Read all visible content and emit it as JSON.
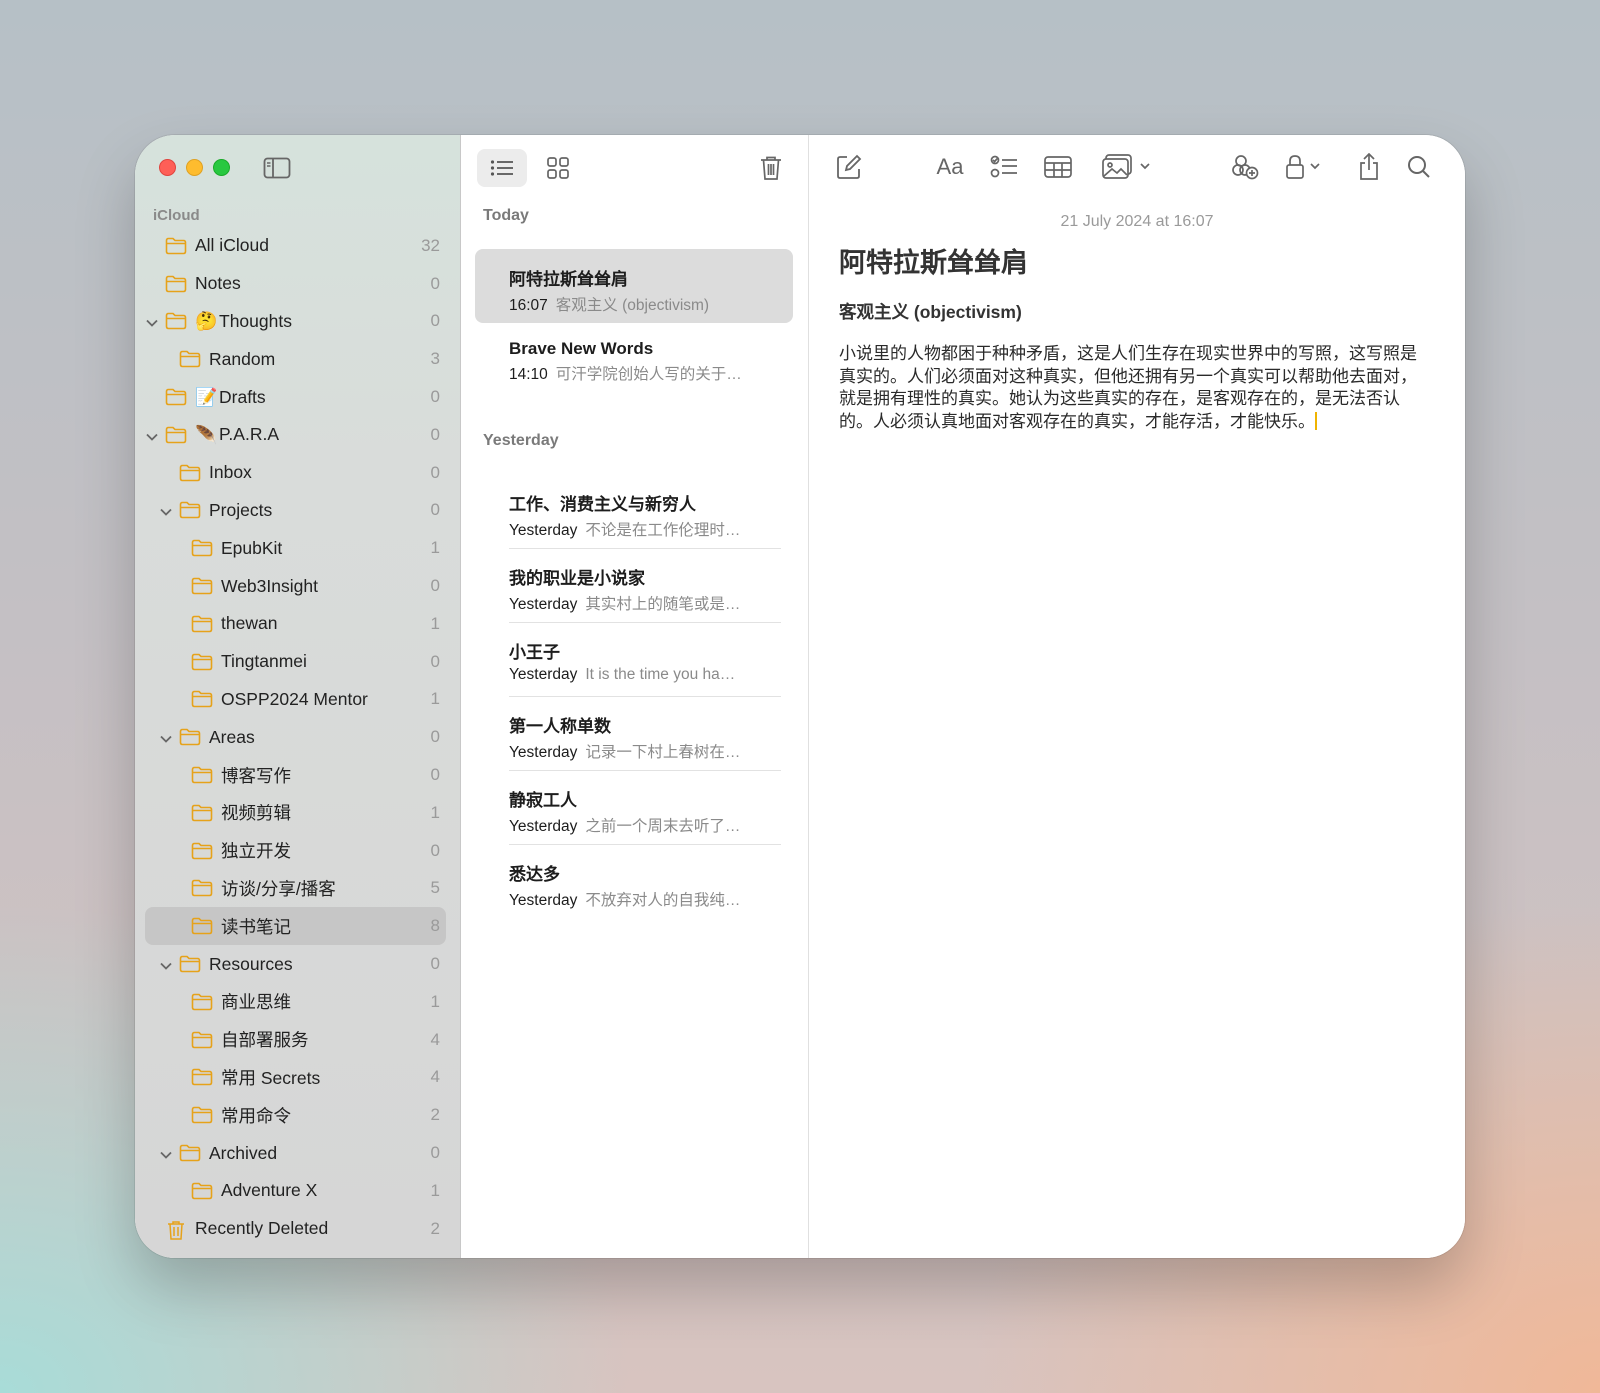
{
  "sidebar": {
    "section_label": "iCloud",
    "folders": [
      {
        "name": "All iCloud",
        "count": "32",
        "indent": 0,
        "chevron": false,
        "emoji": ""
      },
      {
        "name": "Notes",
        "count": "0",
        "indent": 0,
        "chevron": false,
        "emoji": ""
      },
      {
        "name": "Thoughts",
        "count": "0",
        "indent": 0,
        "chevron": true,
        "emoji": "🤔"
      },
      {
        "name": "Random",
        "count": "3",
        "indent": 1,
        "chevron": false,
        "emoji": ""
      },
      {
        "name": "Drafts",
        "count": "0",
        "indent": 0,
        "chevron": false,
        "emoji": "📝"
      },
      {
        "name": "P.A.R.A",
        "count": "0",
        "indent": 0,
        "chevron": true,
        "emoji": "🪶"
      },
      {
        "name": "Inbox",
        "count": "0",
        "indent": 1,
        "chevron": false,
        "emoji": ""
      },
      {
        "name": "Projects",
        "count": "0",
        "indent": 1,
        "chevron": true,
        "emoji": ""
      },
      {
        "name": "EpubKit",
        "count": "1",
        "indent": 2,
        "chevron": false,
        "emoji": ""
      },
      {
        "name": "Web3Insight",
        "count": "0",
        "indent": 2,
        "chevron": false,
        "emoji": ""
      },
      {
        "name": "thewan",
        "count": "1",
        "indent": 2,
        "chevron": false,
        "emoji": ""
      },
      {
        "name": "Tingtanmei",
        "count": "0",
        "indent": 2,
        "chevron": false,
        "emoji": ""
      },
      {
        "name": "OSPP2024 Mentor",
        "count": "1",
        "indent": 2,
        "chevron": false,
        "emoji": ""
      },
      {
        "name": "Areas",
        "count": "0",
        "indent": 1,
        "chevron": true,
        "emoji": ""
      },
      {
        "name": "博客写作",
        "count": "0",
        "indent": 2,
        "chevron": false,
        "emoji": ""
      },
      {
        "name": "视频剪辑",
        "count": "1",
        "indent": 2,
        "chevron": false,
        "emoji": ""
      },
      {
        "name": "独立开发",
        "count": "0",
        "indent": 2,
        "chevron": false,
        "emoji": ""
      },
      {
        "name": "访谈/分享/播客",
        "count": "5",
        "indent": 2,
        "chevron": false,
        "emoji": ""
      },
      {
        "name": "读书笔记",
        "count": "8",
        "indent": 2,
        "chevron": false,
        "emoji": "",
        "selected": true
      },
      {
        "name": "Resources",
        "count": "0",
        "indent": 1,
        "chevron": true,
        "emoji": ""
      },
      {
        "name": "商业思维",
        "count": "1",
        "indent": 2,
        "chevron": false,
        "emoji": ""
      },
      {
        "name": "自部署服务",
        "count": "4",
        "indent": 2,
        "chevron": false,
        "emoji": ""
      },
      {
        "name": "常用 Secrets",
        "count": "4",
        "indent": 2,
        "chevron": false,
        "emoji": ""
      },
      {
        "name": "常用命令",
        "count": "2",
        "indent": 2,
        "chevron": false,
        "emoji": ""
      },
      {
        "name": "Archived",
        "count": "0",
        "indent": 1,
        "chevron": true,
        "emoji": ""
      },
      {
        "name": "Adventure X",
        "count": "1",
        "indent": 2,
        "chevron": false,
        "emoji": ""
      },
      {
        "name": "Recently Deleted",
        "count": "2",
        "indent": 0,
        "chevron": false,
        "emoji": "",
        "trash": true
      }
    ]
  },
  "notelist": {
    "groups": [
      {
        "label": "Today",
        "notes": [
          {
            "title": "阿特拉斯耸耸肩",
            "time": "16:07",
            "preview": "客观主义 (objectivism)",
            "selected": true
          },
          {
            "title": "Brave New Words",
            "time": "14:10",
            "preview": "可汗学院创始人写的关于…"
          }
        ]
      },
      {
        "label": "Yesterday",
        "notes": [
          {
            "title": "工作、消费主义与新穷人",
            "time": "Yesterday",
            "preview": "不论是在工作伦理时…"
          },
          {
            "title": "我的职业是小说家",
            "time": "Yesterday",
            "preview": "其实村上的随笔或是…"
          },
          {
            "title": "小王子",
            "time": "Yesterday",
            "preview": "It is the time you ha…"
          },
          {
            "title": "第一人称单数",
            "time": "Yesterday",
            "preview": "记录一下村上春树在…"
          },
          {
            "title": "静寂工人",
            "time": "Yesterday",
            "preview": "之前一个周末去听了…"
          },
          {
            "title": "悉达多",
            "time": "Yesterday",
            "preview": "不放弃对人的自我纯…"
          }
        ]
      }
    ]
  },
  "editor": {
    "date": "21 July 2024 at 16:07",
    "title": "阿特拉斯耸耸肩",
    "subtitle": "客观主义 (objectivism)",
    "body": "小说里的人物都困于种种矛盾，这是人们生存在现实世界中的写照，这写照是真实的。人们必须面对这种真实，但他还拥有另一个真实可以帮助他去面对，就是拥有理性的真实。她认为这些真实的存在，是客观存在的，是无法否认的。人必须认真地面对客观存在的真实，才能存活，才能快乐。",
    "format_label": "Aa"
  },
  "colors": {
    "folder_accent": "#e6a21a",
    "selection": "#c6c6c6",
    "caret": "#f0b400"
  },
  "icons": [
    "sidebar-toggle-icon",
    "list-view-icon",
    "gallery-view-icon",
    "trash-icon",
    "compose-icon",
    "checklist-icon",
    "table-icon",
    "media-icon",
    "collaborate-icon",
    "lock-icon",
    "share-icon",
    "search-icon",
    "folder-icon",
    "chevron-down-icon"
  ]
}
